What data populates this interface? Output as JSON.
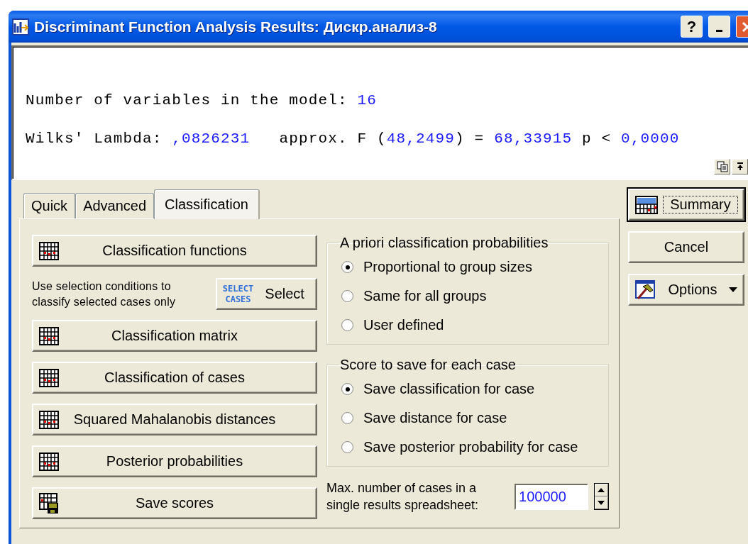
{
  "window": {
    "title": "Discriminant Function Analysis Results: Дискр.анализ-8",
    "help_label": "?"
  },
  "output": {
    "lines": [
      [
        {
          "text": "Number of variables in the model: ",
          "kind": "label"
        },
        {
          "text": "16",
          "kind": "value"
        }
      ],
      [
        {
          "text": "Wilks' Lambda: ",
          "kind": "label"
        },
        {
          "text": ",0826231",
          "kind": "value"
        },
        {
          "text": "   approx. F (",
          "kind": "label"
        },
        {
          "text": "48,2499",
          "kind": "value"
        },
        {
          "text": ") = ",
          "kind": "label"
        },
        {
          "text": "68,33915",
          "kind": "value"
        },
        {
          "text": " p < ",
          "kind": "label"
        },
        {
          "text": "0,0000",
          "kind": "value"
        }
      ]
    ]
  },
  "tabs": [
    {
      "label": "Quick",
      "selected": false
    },
    {
      "label": "Advanced",
      "selected": false
    },
    {
      "label": "Classification",
      "selected": true
    }
  ],
  "actions": [
    {
      "kind": "table",
      "label": "Classification functions"
    },
    {
      "kind": "select",
      "note": "Use selection conditions to classify selected cases only",
      "icon_text": [
        "SELECT",
        "CASES"
      ],
      "label": "Select"
    },
    {
      "kind": "table",
      "label": "Classification matrix"
    },
    {
      "kind": "table",
      "label": "Classification of cases"
    },
    {
      "kind": "table",
      "label": "Squared Mahalanobis distances"
    },
    {
      "kind": "table",
      "label": "Posterior probabilities"
    },
    {
      "kind": "save",
      "label": "Save scores"
    }
  ],
  "groups": [
    {
      "title": "A priori classification probabilities",
      "options": [
        {
          "label": "Proportional to group sizes",
          "selected": true
        },
        {
          "label": "Same for all groups",
          "selected": false
        },
        {
          "label": "User defined",
          "selected": false
        }
      ]
    },
    {
      "title": "Score to save for each case",
      "options": [
        {
          "label": "Save classification for case",
          "selected": true
        },
        {
          "label": "Save distance for case",
          "selected": false
        },
        {
          "label": "Save posterior probability for case",
          "selected": false
        }
      ]
    }
  ],
  "max_cases": {
    "label_lines": [
      "Max. number of cases in a",
      "single results spreadsheet:"
    ],
    "value": "100000"
  },
  "side_buttons": [
    {
      "kind": "summary",
      "label": "Summary",
      "default": true
    },
    {
      "kind": "plain",
      "label": "Cancel",
      "default": false
    },
    {
      "kind": "options",
      "label": "Options",
      "default": false
    }
  ]
}
